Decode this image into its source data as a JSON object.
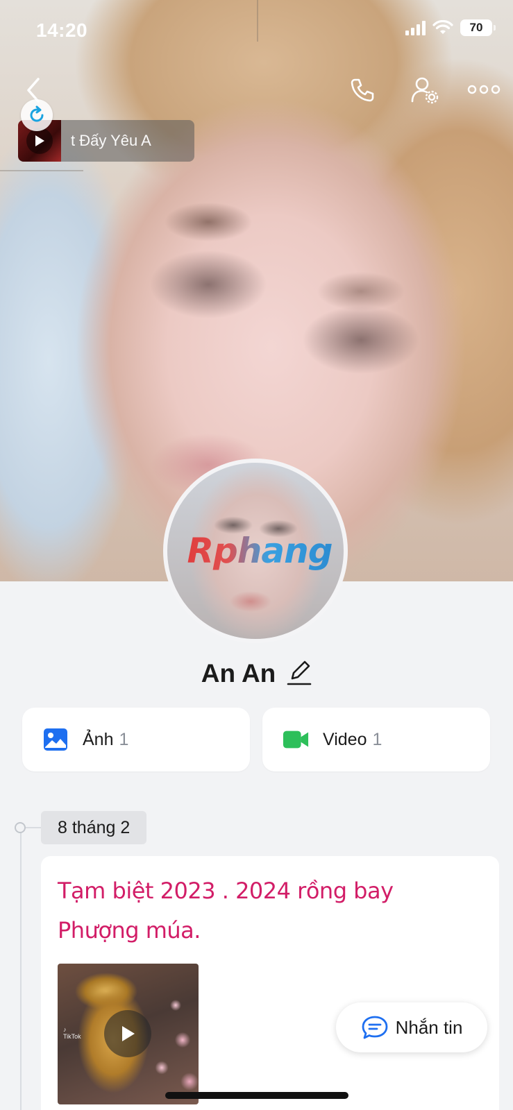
{
  "status_bar": {
    "time": "14:20",
    "battery": "70"
  },
  "music_player": {
    "title": "t Đấy        Yêu A"
  },
  "profile": {
    "name": "An An",
    "avatar_watermark": "Rphang"
  },
  "media_cards": [
    {
      "label": "Ảnh",
      "count": "1",
      "icon": "image-icon",
      "color": "#1e6ff0"
    },
    {
      "label": "Video",
      "count": "1",
      "icon": "video-camera-icon",
      "color": "#2dbf5a"
    }
  ],
  "timeline": {
    "date": "8 tháng 2",
    "post": {
      "text": "Tạm biệt 2023 . 2024 rồng bay Phượng múa.",
      "media_caption": "TikTok"
    }
  },
  "message_button": {
    "label": "Nhắn tin"
  },
  "colors": {
    "accent": "#1e6ff0",
    "post_text": "#d21d67",
    "video_green": "#2dbf5a"
  }
}
